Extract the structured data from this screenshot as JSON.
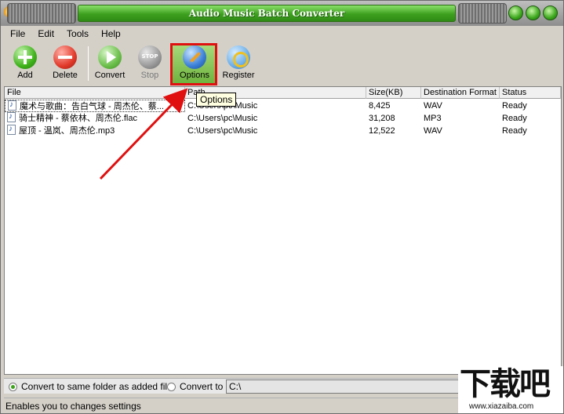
{
  "window": {
    "title": "Audio Music Batch Converter"
  },
  "menu": [
    {
      "label": "File"
    },
    {
      "label": "Edit"
    },
    {
      "label": "Tools"
    },
    {
      "label": "Help"
    }
  ],
  "toolbar": {
    "add": "Add",
    "delete": "Delete",
    "convert": "Convert",
    "stop": "Stop",
    "options": "Options",
    "register": "Register"
  },
  "tooltip": "Options",
  "table": {
    "columns": [
      "File",
      "Path",
      "Size(KB)",
      "Destination Format",
      "Status"
    ],
    "rows": [
      {
        "file": "魔术与歌曲：告白气球 - 周杰伦、蔡...",
        "path": "C:\\Users\\pc\\Music",
        "size": "8,425",
        "format": "WAV",
        "status": "Ready"
      },
      {
        "file": "骑士精神 - 蔡依林、周杰伦.flac",
        "path": "C:\\Users\\pc\\Music",
        "size": "31,208",
        "format": "MP3",
        "status": "Ready"
      },
      {
        "file": "屋顶 - 温岚、周杰伦.mp3",
        "path": "C:\\Users\\pc\\Music",
        "size": "12,522",
        "format": "WAV",
        "status": "Ready"
      }
    ]
  },
  "destination": {
    "same_folder_label": "Convert to same folder as added file",
    "convert_to_label": "Convert to",
    "path_value": "C:\\",
    "selected": "same_folder"
  },
  "status_text": "Enables you to changes settings",
  "watermark": {
    "text": "下载吧",
    "url": "www.xiazaiba.com"
  },
  "colors": {
    "title_green": "#3da01f",
    "highlight_red": "#e01010",
    "tooltip_bg": "#ffffe1"
  }
}
